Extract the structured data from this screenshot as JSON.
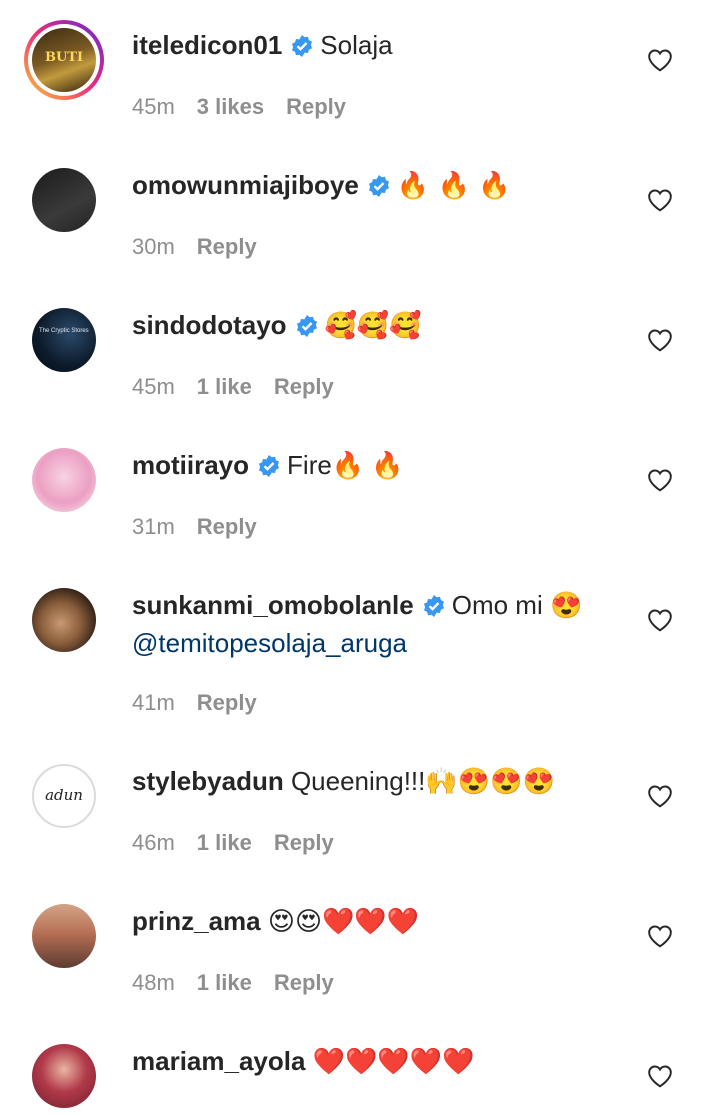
{
  "comments": [
    {
      "username": "iteledicon01",
      "verified": true,
      "text": "Solaja",
      "mention": "",
      "time": "45m",
      "likes": "3 likes",
      "reply": "Reply",
      "avatar_text": "BUTI"
    },
    {
      "username": "omowunmiajiboye",
      "verified": true,
      "text": "🔥 🔥 🔥",
      "mention": "",
      "time": "30m",
      "likes": "",
      "reply": "Reply"
    },
    {
      "username": "sindodotayo",
      "verified": true,
      "text": "🥰🥰🥰",
      "mention": "",
      "time": "45m",
      "likes": "1 like",
      "reply": "Reply",
      "avatar_text": "The Cryptic Stores"
    },
    {
      "username": "motiirayo",
      "verified": true,
      "text": "Fire🔥 🔥",
      "mention": "",
      "time": "31m",
      "likes": "",
      "reply": "Reply"
    },
    {
      "username": "sunkanmi_omobolanle",
      "verified": true,
      "text": "Omo mi 😍",
      "mention": "@temitopesolaja_aruga",
      "time": "41m",
      "likes": "",
      "reply": "Reply"
    },
    {
      "username": "stylebyadun",
      "verified": false,
      "text": "Queening!!!🙌😍😍😍",
      "mention": "",
      "time": "46m",
      "likes": "1 like",
      "reply": "Reply",
      "avatar_text": "adun"
    },
    {
      "username": "prinz_ama",
      "verified": false,
      "text": "😍😍❤️❤️❤️",
      "mention": "",
      "time": "48m",
      "likes": "1 like",
      "reply": "Reply"
    },
    {
      "username": "mariam_ayola",
      "verified": false,
      "text": "❤️❤️❤️❤️❤️",
      "mention": "",
      "time": "",
      "likes": "",
      "reply": ""
    }
  ],
  "colors": {
    "verified": "#3897f0",
    "meta": "#8e8e8e",
    "mention": "#00376b"
  }
}
